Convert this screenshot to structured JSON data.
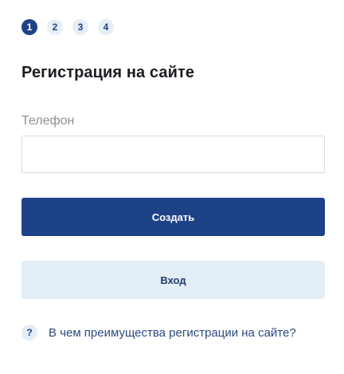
{
  "steps": [
    {
      "label": "1",
      "active": true
    },
    {
      "label": "2",
      "active": false
    },
    {
      "label": "3",
      "active": false
    },
    {
      "label": "4",
      "active": false
    }
  ],
  "form": {
    "title": "Регистрация на сайте",
    "phone_label": "Телефон",
    "phone_value": "",
    "phone_placeholder": ""
  },
  "buttons": {
    "create_label": "Создать",
    "login_label": "Вход"
  },
  "help": {
    "icon": "question-icon",
    "icon_glyph": "?",
    "link_text": "В чем преимущества регистрации на сайте?"
  },
  "colors": {
    "primary": "#1e4287",
    "secondary_bg": "#e4eef7",
    "step_inactive_bg": "#e6eef6",
    "label_gray": "#8b8f96",
    "input_border": "#d7dbe0"
  }
}
